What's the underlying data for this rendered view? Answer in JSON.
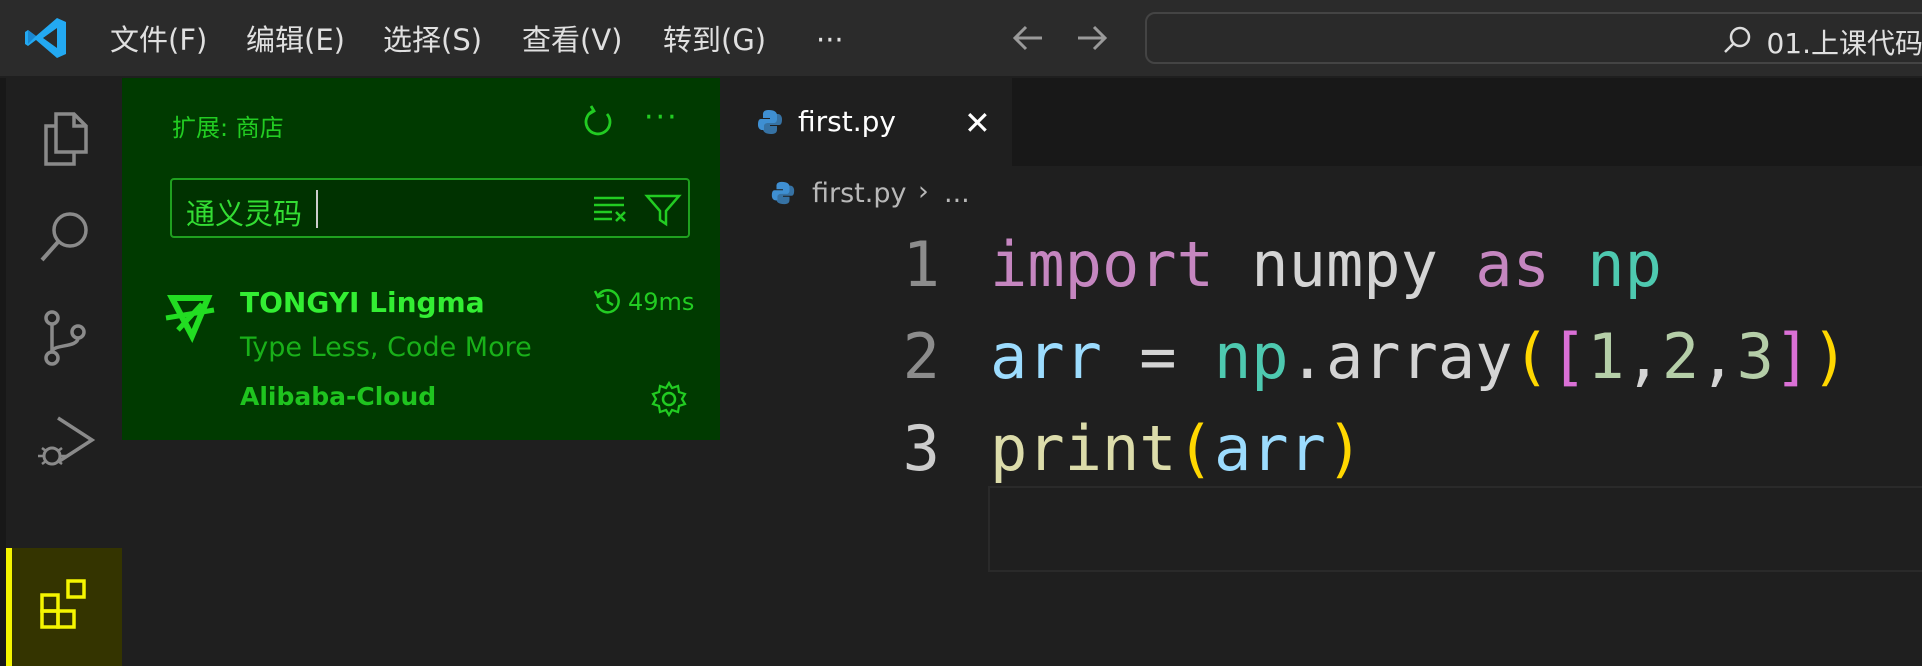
{
  "menu": [
    "文件(F)",
    "编辑(E)",
    "选择(S)",
    "查看(V)",
    "转到(G)",
    "···"
  ],
  "command_center": {
    "text": "01.上课代码"
  },
  "sidebar": {
    "title": "扩展: 商店",
    "more": "···",
    "search": {
      "value": "通义灵码"
    },
    "extension": {
      "name": "TONGYI Lingma",
      "time": "49ms",
      "description": "Type Less, Code More",
      "publisher": "Alibaba-Cloud"
    }
  },
  "editor": {
    "tab": {
      "label": "first.py",
      "close": "✕"
    },
    "breadcrumb": {
      "file": "first.py",
      "sep": "›",
      "more": "..."
    },
    "lines": [
      {
        "no": "1",
        "tokens": [
          {
            "t": "import",
            "c": "kw"
          },
          {
            "t": " ",
            "c": "id"
          },
          {
            "t": "numpy",
            "c": "id"
          },
          {
            "t": " ",
            "c": "id"
          },
          {
            "t": "as",
            "c": "kw"
          },
          {
            "t": " ",
            "c": "id"
          },
          {
            "t": "np",
            "c": "ns"
          }
        ]
      },
      {
        "no": "2",
        "tokens": [
          {
            "t": "arr",
            "c": "var"
          },
          {
            "t": " = ",
            "c": "id"
          },
          {
            "t": "np",
            "c": "ns"
          },
          {
            "t": ".",
            "c": "id"
          },
          {
            "t": "array",
            "c": "id"
          },
          {
            "t": "(",
            "c": "br1"
          },
          {
            "t": "[",
            "c": "br2"
          },
          {
            "t": "1",
            "c": "num"
          },
          {
            "t": ",",
            "c": "id"
          },
          {
            "t": "2",
            "c": "num"
          },
          {
            "t": ",",
            "c": "id"
          },
          {
            "t": "3",
            "c": "num"
          },
          {
            "t": "]",
            "c": "br2"
          },
          {
            "t": ")",
            "c": "br1"
          }
        ]
      },
      {
        "no": "3",
        "tokens": [
          {
            "t": "print",
            "c": "fn"
          },
          {
            "t": "(",
            "c": "br1"
          },
          {
            "t": "arr",
            "c": "var"
          },
          {
            "t": ")",
            "c": "br1"
          }
        ]
      }
    ]
  },
  "colors": {
    "accent_green": "#22cc22",
    "active_activity": "#f5f500"
  }
}
